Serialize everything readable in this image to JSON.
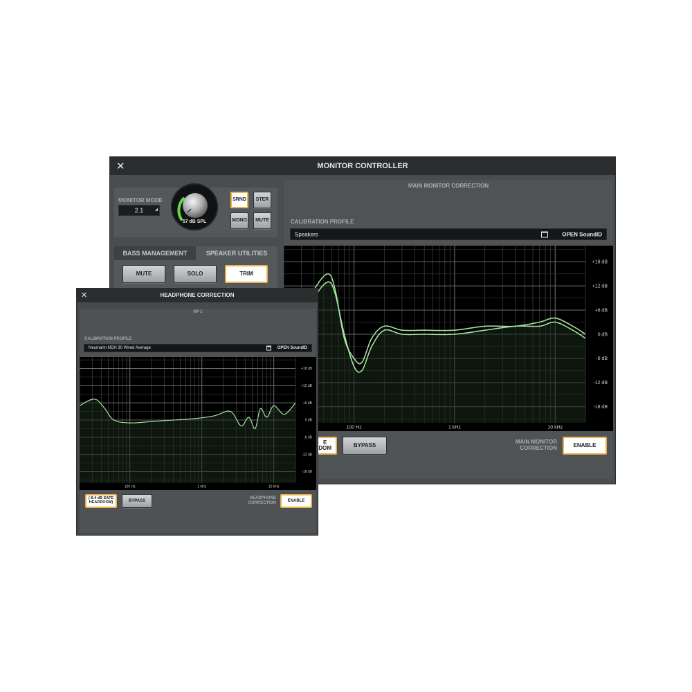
{
  "main": {
    "title": "MONITOR CONTROLLER",
    "close_icon": "close-icon",
    "monitor_mode": {
      "label": "MONITOR MODE",
      "value": "2.1"
    },
    "knob": {
      "readout": "57 dB SPL"
    },
    "mode_buttons": {
      "srnd": "SRND",
      "ster": "STER",
      "mono": "MONO",
      "mute": "MUTE"
    },
    "tabs": {
      "bass": "BASS MANAGEMENT",
      "utilities": "SPEAKER UTILITIES"
    },
    "util_buttons": {
      "mute": "MUTE",
      "solo": "SOLO",
      "trim": "TRIM"
    },
    "correction": {
      "header": "MAIN MONITOR CORRECTION",
      "profile_label": "CALIBRATION PROFILE",
      "profile_value": "Speakers",
      "open_label": "OPEN SoundID",
      "hidden_button": "E\nDOM",
      "bypass": "BYPASS",
      "enable_label": "MAIN MONITOR\nCORRECTION",
      "enable": "ENABLE"
    },
    "graph": {
      "db_labels": [
        "+18 dB",
        "+12 dB",
        "+6 dB",
        "0 dB",
        "-6 dB",
        "-12 dB",
        "-18 dB"
      ],
      "freq_labels": [
        "100 Hz",
        "1 kHz",
        "10 kHz"
      ]
    }
  },
  "headphone": {
    "title": "HEADPHONE CORRECTION",
    "close_icon": "close-icon",
    "hp_label": "HP 1",
    "profile_label": "CALIBRATION PROFILE",
    "profile_value": "Neumann NDH 30 Wired Average",
    "open_label": "OPEN SoundID",
    "safe_headroom": "(-8.4 dB SAFE\nHEADROOM)",
    "bypass": "BYPASS",
    "enable_label": "HEADPHONE\nCORRECTION",
    "enable": "ENABLE",
    "graph": {
      "db_labels": [
        "+18 dB",
        "+12 dB",
        "+6 dB",
        "0 dB",
        "-6 dB",
        "-12 dB",
        "-18 dB"
      ],
      "freq_labels": [
        "100 Hz",
        "1 kHz",
        "10 kHz"
      ]
    }
  },
  "colors": {
    "curve": "#a6e3a0",
    "curve_fill": "#1a2a1a",
    "accent_border": "#e8b34a",
    "knob_ring": "#63d84a"
  },
  "chart_data": [
    {
      "type": "line",
      "xscale": "log",
      "xlim": [
        20,
        20000
      ],
      "ylim": [
        -22,
        22
      ],
      "x": [
        20,
        30,
        40,
        55,
        65,
        80,
        100,
        120,
        150,
        200,
        300,
        500,
        1000,
        2000,
        4000,
        7000,
        10000,
        15000,
        20000
      ],
      "series": [
        {
          "values": [
            -6,
            2,
            9,
            13,
            10,
            0,
            -8,
            -9,
            -3,
            1,
            0,
            0,
            0,
            1,
            2,
            2,
            3,
            1,
            -1
          ]
        },
        {
          "values": [
            -5,
            4,
            11,
            15,
            11,
            -1,
            -6,
            -7,
            -1,
            2,
            1,
            1,
            1,
            2,
            2,
            3,
            4,
            2,
            0
          ]
        }
      ],
      "yticks": [
        "+18 dB",
        "+12 dB",
        "+6 dB",
        "0 dB",
        "-6 dB",
        "-12 dB",
        "-18 dB"
      ],
      "xticks": [
        "100 Hz",
        "1 kHz",
        "10 kHz"
      ]
    },
    {
      "type": "line",
      "xscale": "log",
      "xlim": [
        20,
        20000
      ],
      "ylim": [
        -22,
        22
      ],
      "x": [
        20,
        28,
        35,
        45,
        60,
        100,
        200,
        400,
        800,
        1500,
        2500,
        3500,
        4500,
        5500,
        6500,
        8000,
        10000,
        14000,
        20000
      ],
      "series": [
        {
          "values": [
            5,
            7,
            7,
            4,
            0,
            -1,
            -0.5,
            0,
            0.5,
            1.5,
            3,
            -2,
            1,
            -3,
            4,
            1,
            5,
            2,
            6
          ]
        }
      ],
      "yticks": [
        "+18 dB",
        "+12 dB",
        "+6 dB",
        "0 dB",
        "-6 dB",
        "-12 dB",
        "-18 dB"
      ],
      "xticks": [
        "100 Hz",
        "1 kHz",
        "10 kHz"
      ]
    }
  ]
}
